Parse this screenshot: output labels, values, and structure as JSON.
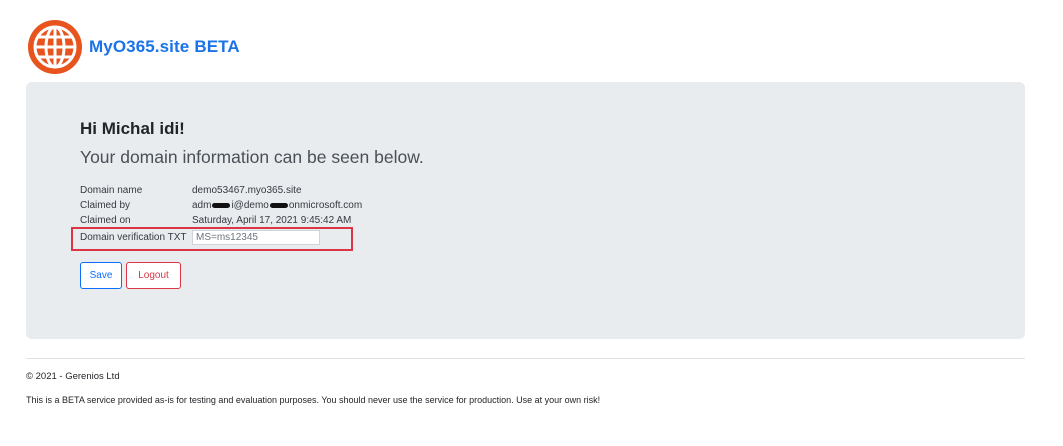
{
  "header": {
    "brand_name": "MyO365.site",
    "brand_badge": "BETA",
    "logo_icon": "globe-icon",
    "brand_color": "#1a73e8",
    "logo_color": "#e8541e"
  },
  "main": {
    "greeting": "Hi Michal idi!",
    "lead": "Your domain information can be seen below.",
    "fields": {
      "domain_name_label": "Domain name",
      "domain_name_value": "demo53467.myo365.site",
      "claimed_by_label": "Claimed by",
      "claimed_by_part1": "adm",
      "claimed_by_part2": "i@demo",
      "claimed_by_part3": "onmicrosoft.com",
      "claimed_on_label": "Claimed on",
      "claimed_on_value": "Saturday, April 17, 2021 9:45:42 AM",
      "txt_label": "Domain verification TXT",
      "txt_value": "MS=ms12345"
    },
    "buttons": {
      "save": "Save",
      "logout": "Logout"
    }
  },
  "footer": {
    "copyright": "© 2021 - Gerenios Ltd",
    "disclaimer": "This is a BETA service provided as-is for testing and evaluation purposes. You should never use the service for production. Use at your own risk!"
  }
}
